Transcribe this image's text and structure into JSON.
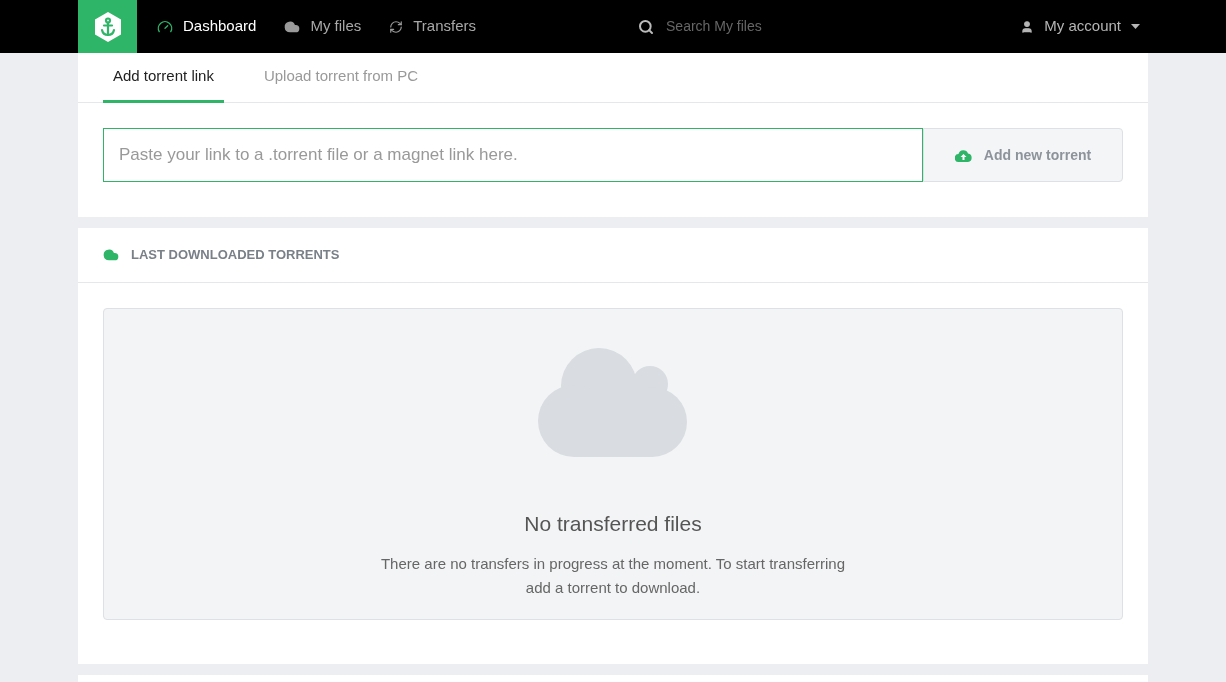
{
  "nav": {
    "items": [
      {
        "kind": "dashboard",
        "label": "Dashboard",
        "selected": true
      },
      {
        "kind": "files",
        "label": "My files",
        "selected": false
      },
      {
        "kind": "transfers",
        "label": "Transfers",
        "selected": false
      }
    ],
    "search": {
      "placeholder": "Search My files"
    },
    "account": {
      "label": "My account"
    }
  },
  "tabs": [
    {
      "label": "Add torrent link",
      "selected": true
    },
    {
      "label": "Upload torrent from PC",
      "selected": false
    }
  ],
  "link_field": {
    "placeholder": "Paste your link to a .torrent file or a magnet link here."
  },
  "add_button": {
    "label": "Add new torrent"
  },
  "last_downloaded": {
    "title": "LAST DOWNLOADED TORRENTS",
    "empty_title": "No transferred files",
    "empty_text": "There are no transfers in progress at the moment. To start transferring add a torrent to download."
  }
}
